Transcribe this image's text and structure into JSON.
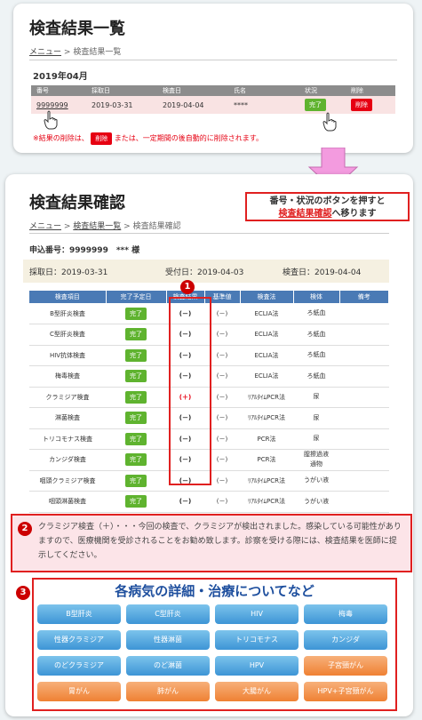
{
  "list_page": {
    "title": "検査結果一覧",
    "breadcrumb": {
      "menu": "メニュー",
      "sep": ">",
      "current": "検査結果一覧"
    },
    "month": "2019年04月",
    "headers": [
      "番号",
      "採取日",
      "検査日",
      "氏名",
      "状況",
      "削除"
    ],
    "row": {
      "number": "9999999",
      "collect_date": "2019-03-31",
      "test_date": "2019-04-04",
      "name": "****",
      "status": "完了",
      "delete": "削除"
    },
    "note_before": "※結果の削除は、",
    "note_button": "削除",
    "note_after": "または、一定期間の後自動的に削除されます。"
  },
  "callout": {
    "line1": "番号・状況のボタンを押すと",
    "highlight": "検査結果確認",
    "line2_rest": "へ移ります"
  },
  "detail_page": {
    "title": "検査結果確認",
    "breadcrumb": {
      "menu": "メニュー",
      "list": "検査結果一覧",
      "current": "検査結果確認"
    },
    "applicant": "申込番号：9999999　*** 様",
    "collect": "採取日：2019-03-31",
    "received": "受付日：2019-04-03",
    "tested": "検査日：2019-04-04",
    "headers": [
      "検査項目",
      "完了予定日",
      "検査結果",
      "基準値",
      "検査法",
      "検体",
      "備考"
    ],
    "rows": [
      {
        "item": "B型肝炎検査",
        "done": "完了",
        "result": "(－)",
        "ref": "(－)",
        "method": "ECLIA法",
        "sample": "ろ紙血"
      },
      {
        "item": "C型肝炎検査",
        "done": "完了",
        "result": "(－)",
        "ref": "(－)",
        "method": "ECLIA法",
        "sample": "ろ紙血"
      },
      {
        "item": "HIV抗体検査",
        "done": "完了",
        "result": "(－)",
        "ref": "(－)",
        "method": "ECLIA法",
        "sample": "ろ紙血"
      },
      {
        "item": "梅毒検査",
        "done": "完了",
        "result": "(－)",
        "ref": "(－)",
        "method": "ECLIA法",
        "sample": "ろ紙血"
      },
      {
        "item": "クラミジア検査",
        "done": "完了",
        "result": "(＋)",
        "ref": "(－)",
        "method": "ﾘｱﾙﾀｲﾑPCR法",
        "sample": "尿"
      },
      {
        "item": "淋菌検査",
        "done": "完了",
        "result": "(－)",
        "ref": "(－)",
        "method": "ﾘｱﾙﾀｲﾑPCR法",
        "sample": "尿"
      },
      {
        "item": "トリコモナス検査",
        "done": "完了",
        "result": "(－)",
        "ref": "(－)",
        "method": "PCR法",
        "sample": "尿"
      },
      {
        "item": "カンジダ検査",
        "done": "完了",
        "result": "(－)",
        "ref": "(－)",
        "method": "PCR法",
        "sample": "膣擦過液\n通物"
      },
      {
        "item": "咽頭クラミジア検査",
        "done": "完了",
        "result": "(－)",
        "ref": "(－)",
        "method": "ﾘｱﾙﾀｲﾑPCR法",
        "sample": "うがい液"
      },
      {
        "item": "咽頭淋菌検査",
        "done": "完了",
        "result": "(－)",
        "ref": "(－)",
        "method": "ﾘｱﾙﾀｲﾑPCR法",
        "sample": "うがい液"
      }
    ],
    "message": "クラミジア検査（＋）・・・今回の検査で、クラミジアが検出されました。感染している可能性がありますので、医療機関を受診されることをお勧め致します。診察を受ける際には、検査結果を医師に提示してください。",
    "disease_title": "各病気の詳細・治療についてなど",
    "disease_buttons": [
      "B型肝炎",
      "C型肝炎",
      "HIV",
      "梅毒",
      "性器クラミジア",
      "性器淋菌",
      "トリコモナス",
      "カンジダ",
      "のどクラミジア",
      "のど淋菌",
      "HPV",
      "子宮頸がん",
      "胃がん",
      "肺がん",
      "大腸がん",
      "HPV+子宮頸がん"
    ]
  },
  "badges": [
    "1",
    "2",
    "3"
  ],
  "colors": {
    "header_blue": "#4a7ab5",
    "complete_green": "#5fb32f",
    "delete_red": "#e60012",
    "annotation_red": "#e02020",
    "button_blue": "#3d95d6",
    "button_orange": "#ef8133"
  }
}
